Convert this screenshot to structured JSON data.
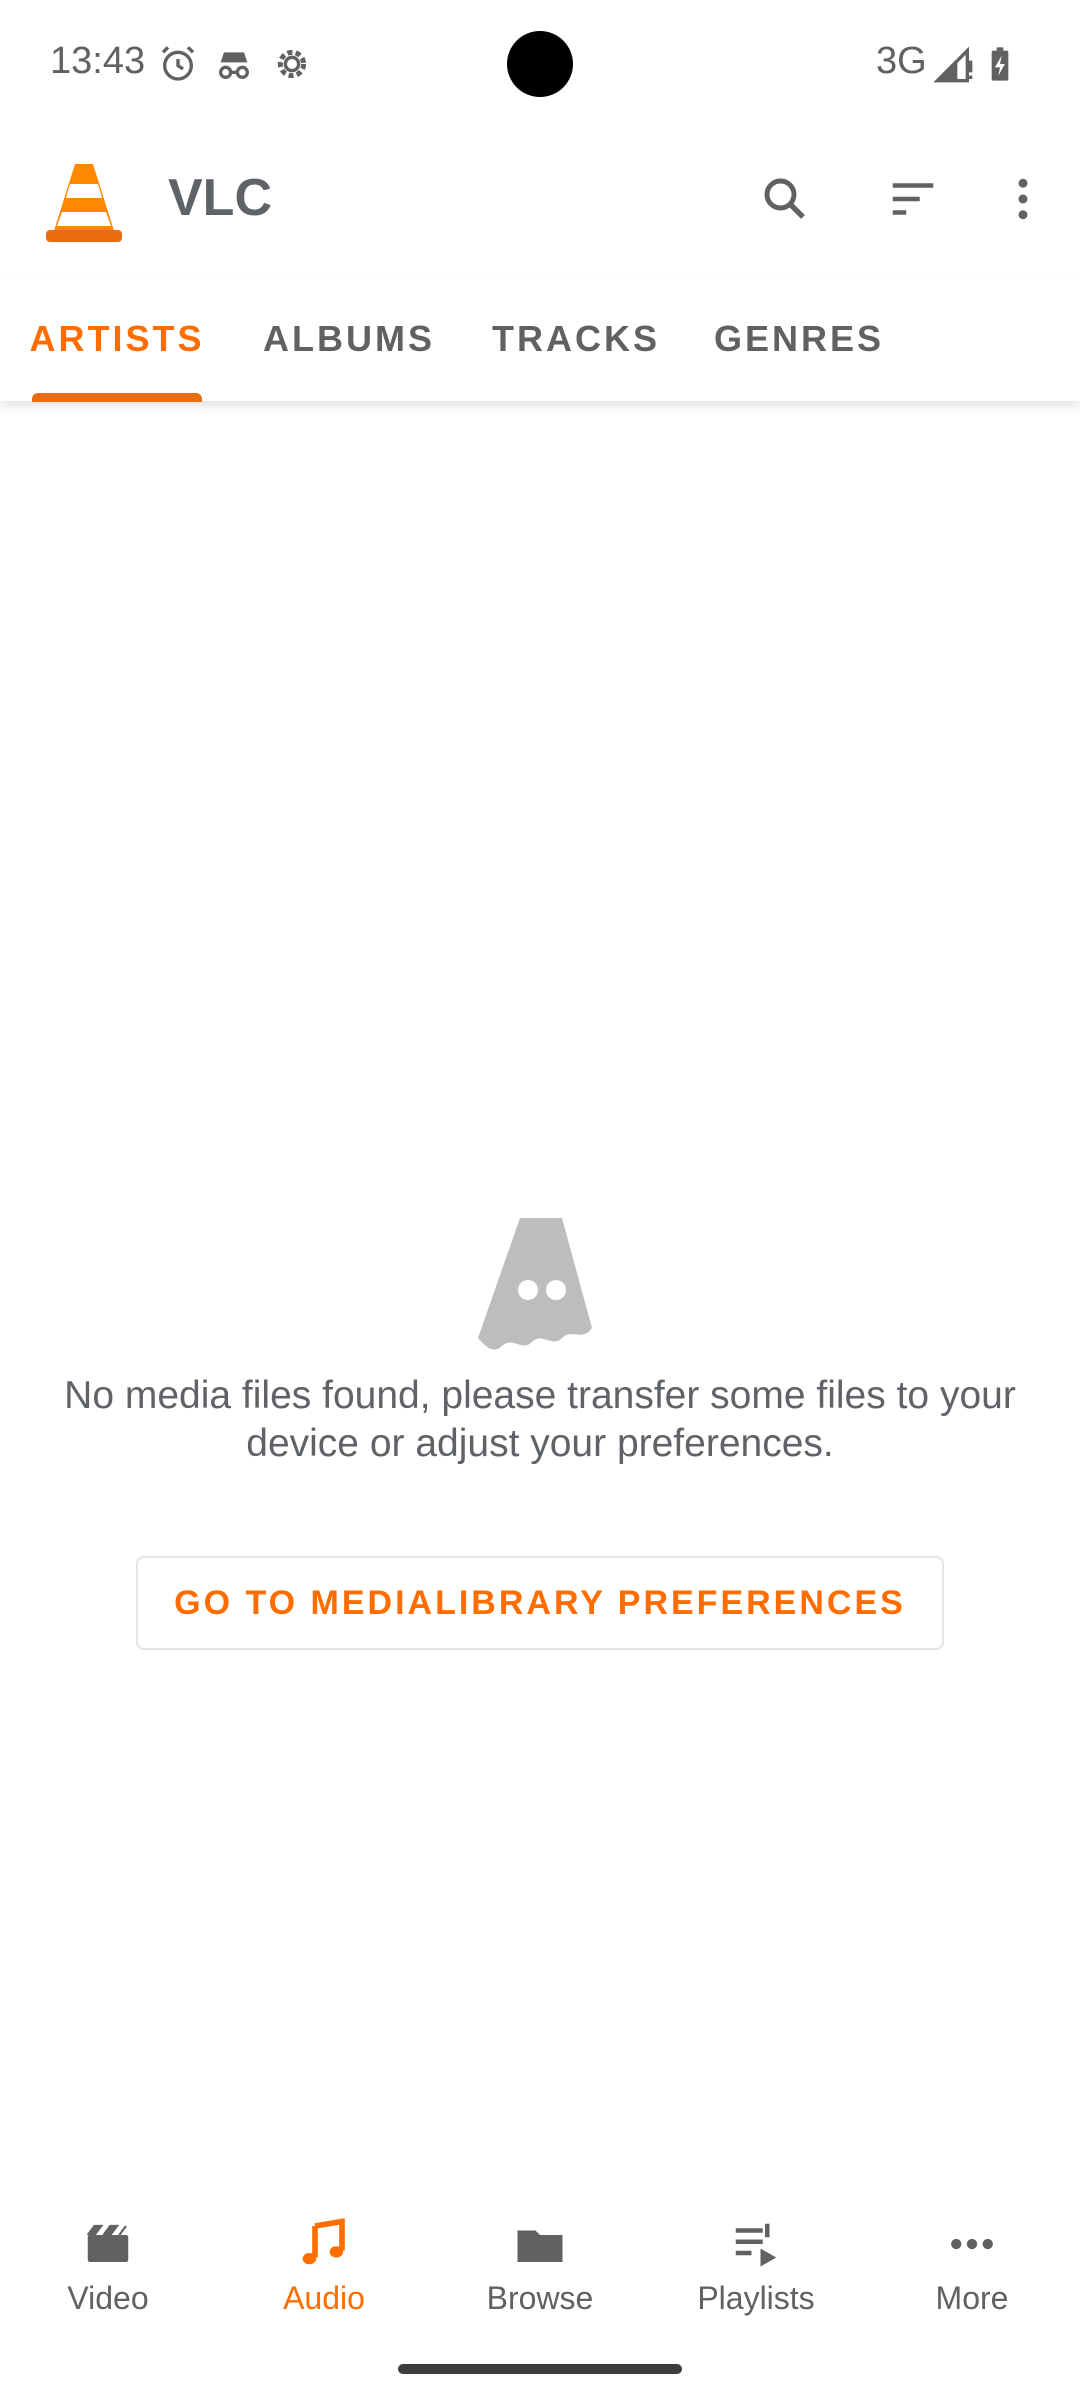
{
  "status_bar": {
    "time": "13:43",
    "network": "3G",
    "icons": [
      "alarm-icon",
      "incognito-icon",
      "settings-gear-icon",
      "signal-icon",
      "battery-charging-icon"
    ]
  },
  "app_bar": {
    "title": "VLC",
    "logo": "vlc-cone-logo",
    "actions": [
      "search-icon",
      "sort-icon",
      "more-vert-icon"
    ]
  },
  "tabs": [
    {
      "label": "ARTISTS",
      "active": true
    },
    {
      "label": "ALBUMS",
      "active": false
    },
    {
      "label": "TRACKS",
      "active": false
    },
    {
      "label": "GENRES",
      "active": false
    }
  ],
  "empty_state": {
    "icon": "ghost-cone-icon",
    "message": "No media files found, please transfer some files to your device or adjust your preferences.",
    "button_label": "GO TO MEDIALIBRARY PREFERENCES"
  },
  "bottom_nav": [
    {
      "label": "Video",
      "icon": "video-clapper-icon",
      "active": false
    },
    {
      "label": "Audio",
      "icon": "music-note-icon",
      "active": true
    },
    {
      "label": "Browse",
      "icon": "folder-icon",
      "active": false
    },
    {
      "label": "Playlists",
      "icon": "playlist-icon",
      "active": false
    },
    {
      "label": "More",
      "icon": "more-horiz-icon",
      "active": false
    }
  ],
  "colors": {
    "accent": "#ff6d00",
    "text": "#5f6368",
    "icon_gray": "#616161"
  }
}
